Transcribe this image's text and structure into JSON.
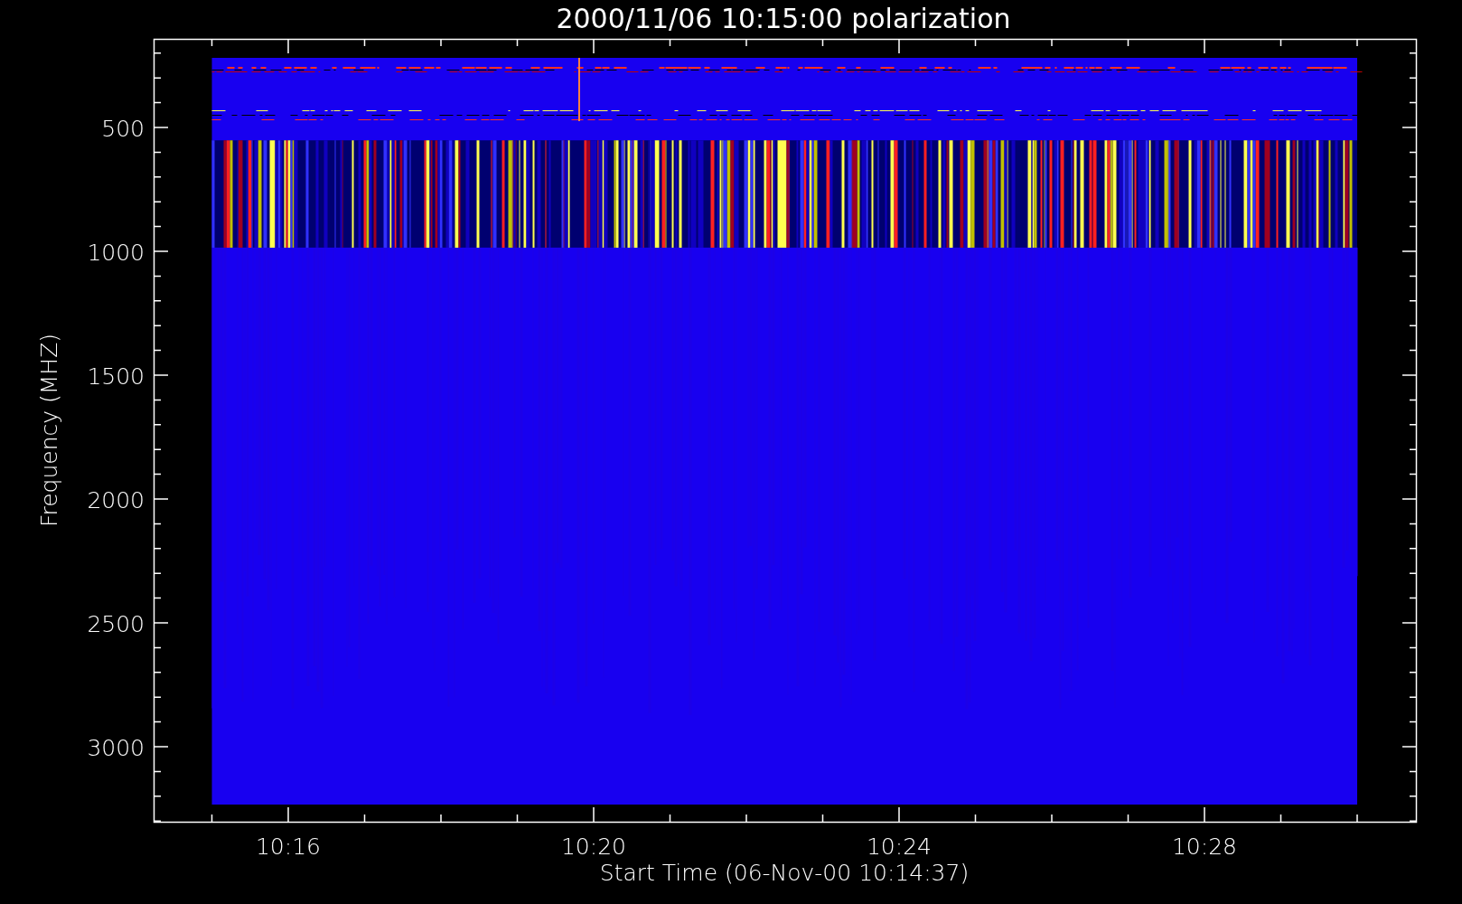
{
  "plot": {
    "title": "2000/11/06 10:15:00 polarization",
    "xlabel": "Start Time (06-Nov-00 10:14:37)",
    "ylabel": "Frequency (MHZ)",
    "xtick_labels": [
      "10:16",
      "10:20",
      "10:24",
      "10:28"
    ],
    "ytick_labels": [
      "500",
      "1000",
      "1500",
      "2000",
      "2500",
      "3000"
    ]
  }
}
